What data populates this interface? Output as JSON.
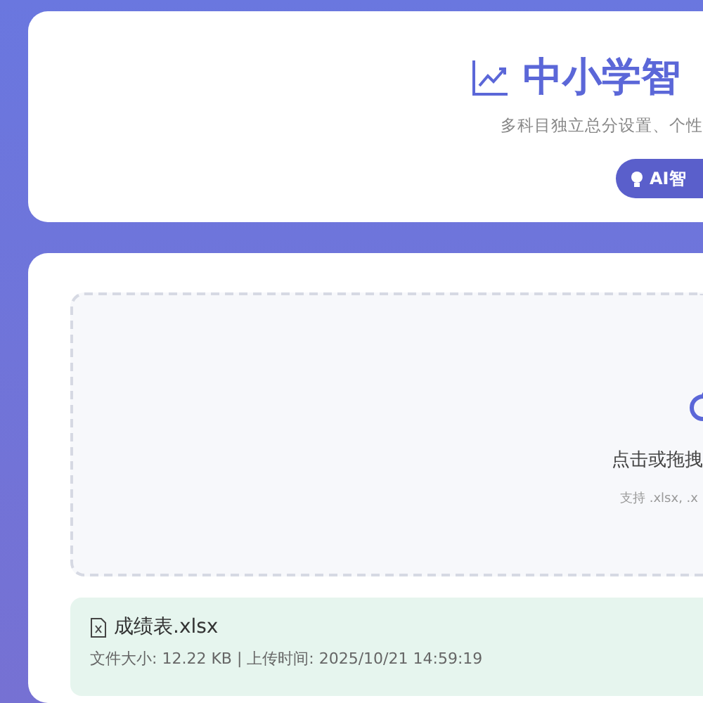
{
  "header": {
    "title": "中小学智",
    "subtitle": "多科目独立总分设置、个性",
    "button": "AI智"
  },
  "upload": {
    "prompt": "点击或拖拽",
    "hint": "支持 .xlsx, .x"
  },
  "file": {
    "name": "成绩表.xlsx",
    "meta": "文件大小: 12.22 KB | 上传时间: 2025/10/21 14:59:19"
  }
}
